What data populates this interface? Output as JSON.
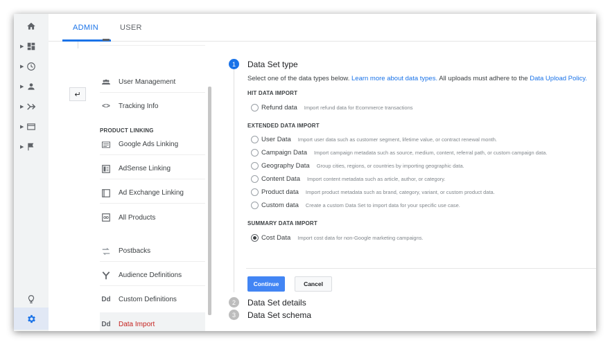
{
  "tabs": {
    "admin": "ADMIN",
    "user": "USER"
  },
  "nav": {
    "items_top": [
      {
        "label": "User Management",
        "icon": "users-icon"
      },
      {
        "label": "Tracking Info",
        "icon": "code-brackets-icon"
      }
    ],
    "section_label": "PRODUCT LINKING",
    "items_product": [
      {
        "label": "Google Ads Linking",
        "icon": "ads-card-icon"
      },
      {
        "label": "AdSense Linking",
        "icon": "adsense-icon"
      },
      {
        "label": "Ad Exchange Linking",
        "icon": "ad-exchange-icon"
      },
      {
        "label": "All Products",
        "icon": "link-icon"
      }
    ],
    "items_bottom": [
      {
        "label": "Postbacks",
        "icon": "postbacks-icon"
      },
      {
        "label": "Audience Definitions",
        "icon": "audience-fork-icon"
      },
      {
        "label": "Custom Definitions",
        "icon": "dd-icon",
        "icon_text": "Dd"
      },
      {
        "label": "Data Import",
        "icon": "dd-icon",
        "icon_text": "Dd"
      }
    ]
  },
  "steps": [
    {
      "number": "1",
      "title": "Data Set type"
    },
    {
      "number": "2",
      "title": "Data Set details"
    },
    {
      "number": "3",
      "title": "Data Set schema"
    }
  ],
  "description": {
    "prefix": "Select one of the data types below.",
    "link1": "Learn more about data types.",
    "middle": "All uploads must adhere to the",
    "link2": "Data Upload Policy."
  },
  "groups": {
    "hit": {
      "label": "HIT DATA IMPORT",
      "options": [
        {
          "label": "Refund data",
          "desc": "Import refund data for Ecommerce transactions",
          "checked": false
        }
      ]
    },
    "extended": {
      "label": "EXTENDED DATA IMPORT",
      "options": [
        {
          "label": "User Data",
          "desc": "Import user data such as customer segment, lifetime value, or contract renewal month.",
          "checked": false
        },
        {
          "label": "Campaign Data",
          "desc": "Import campaign metadata such as source, medium, content, referral path, or custom campaign data.",
          "checked": false
        },
        {
          "label": "Geography Data",
          "desc": "Group cities, regions, or countries by importing geographic data.",
          "checked": false
        },
        {
          "label": "Content Data",
          "desc": "Import content metadata such as article, author, or category.",
          "checked": false
        },
        {
          "label": "Product data",
          "desc": "Import product metadata such as brand, category, variant, or custom product data.",
          "checked": false
        },
        {
          "label": "Custom data",
          "desc": "Create a custom Data Set to import data for your specific use case.",
          "checked": false
        }
      ]
    },
    "summary": {
      "label": "SUMMARY DATA IMPORT",
      "options": [
        {
          "label": "Cost Data",
          "desc": "Import cost data for non-Google marketing campaigns.",
          "checked": true
        }
      ]
    }
  },
  "buttons": {
    "continue": "Continue",
    "cancel": "Cancel"
  },
  "colors": {
    "accent": "#1a73e8",
    "active_nav_text": "#c5221f",
    "button_primary": "#4285f4"
  }
}
